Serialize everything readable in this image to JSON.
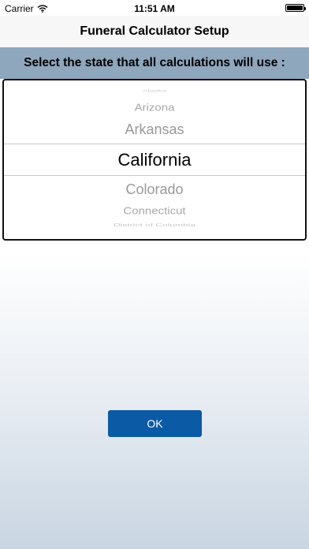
{
  "status_bar": {
    "carrier": "Carrier",
    "time": "11:51 AM"
  },
  "nav": {
    "title": "Funeral Calculator Setup"
  },
  "prompt": {
    "text": "Select the state that all calculations will use :"
  },
  "picker": {
    "items": [
      "Alaska",
      "Arizona",
      "Arkansas",
      "California",
      "Colorado",
      "Connecticut",
      "District of Columbia"
    ],
    "selected": "California"
  },
  "ok_button": {
    "label": "OK"
  },
  "colors": {
    "prompt_bar": "#8fa7bd",
    "ok_button": "#0a5aa6"
  }
}
